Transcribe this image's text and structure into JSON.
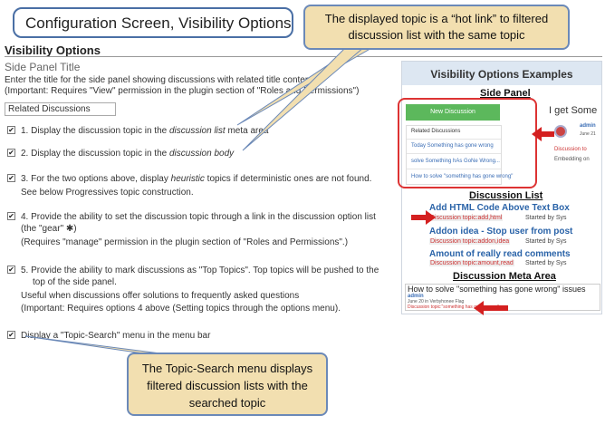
{
  "header": {
    "title_callout": "Configuration Screen, Visibility Options",
    "section_heading": "Visibility Options"
  },
  "settings": {
    "panel_title": "Side Panel Title",
    "panel_desc_1": "Enter the title for the side panel showing discussions with related title content.",
    "panel_desc_2": "(Important: Requires \"View\" permission in the plugin section of \"Roles and Permissions\")",
    "panel_title_value": "Related Discussions",
    "option1_pre": "1. Display the discussion topic in the ",
    "option1_em": "discussion list",
    "option1_post": " meta area",
    "option2_pre": "2. Display the discussion topic in the ",
    "option2_em": "discussion body",
    "option3_pre": "3. For the two options above, display ",
    "option3_em": "heuristic",
    "option3_post": " topics if deterministic ones are not found.",
    "option3_sub": "See below Progressives topic construction.",
    "option4_line1": "4. Provide the ability to set the discussion topic through a link in the discussion option list",
    "option4_line2": "(the \"gear\" ✱)",
    "option4_sub": "(Requires \"manage\" permission in the plugin section of \"Roles and Permissions\".)",
    "option5_line1": "5. Provide the ability to mark discussions as \"Top Topics\". Top topics will be pushed to the",
    "option5_line2": "top of the side panel.",
    "option5_sub1": "Useful when discussions offer solutions to frequently asked questions",
    "option5_sub2": "(Important: Requires options 4 above (Setting topics through the options menu).",
    "option6": "Display a \"Topic-Search\" menu in the menu bar",
    "checkbox_mark": "✔"
  },
  "callouts": {
    "hot_link_line1": "The displayed topic is a “hot link” to filtered",
    "hot_link_line2": "discussion list with the same topic",
    "search_line1": "The Topic-Search menu displays",
    "search_line2": "filtered discussion lists with the",
    "search_line3": "searched topic"
  },
  "examples": {
    "header": "Visibility Options Examples",
    "side_panel": "Side Panel",
    "new_discussion": "New Discussion",
    "related_heading": "Related Discussions",
    "related_items": [
      "Today Something has gone wrong",
      "solve Something hAs GoNe Wrong...",
      "How to solve \"something has gone wrong\""
    ],
    "get_some": "I get Some",
    "admin": "admin",
    "june": "June 21",
    "discussion_topic": "Discussion to",
    "embedding": "Embedding on",
    "discussion_list": "Discussion List",
    "dl_items": [
      {
        "title": "Add HTML Code Above Text Box",
        "tag": "Discussion topic:add,html",
        "by": "Started by Sys"
      },
      {
        "title": "Addon idea - Stop user from post",
        "tag": "Discussion topic:addon,idea",
        "by": "Started by Sys"
      },
      {
        "title": "Amount of really read comments",
        "tag": "Discussion topic:amount,read",
        "by": "Started by Sys"
      }
    ],
    "meta_area": "Discussion Meta Area",
    "meta_question": "How to solve \"something has gone wrong\" issues",
    "meta_admin": "admin",
    "meta_details": "June 20    in Verbyhonee        Flag",
    "meta_tag": "Discussion topic:\"something has gone wrong\""
  },
  "colors": {
    "accent_red": "#d42020",
    "callout_fill": "#f2dfb0",
    "callout_border": "#6b89b8"
  }
}
